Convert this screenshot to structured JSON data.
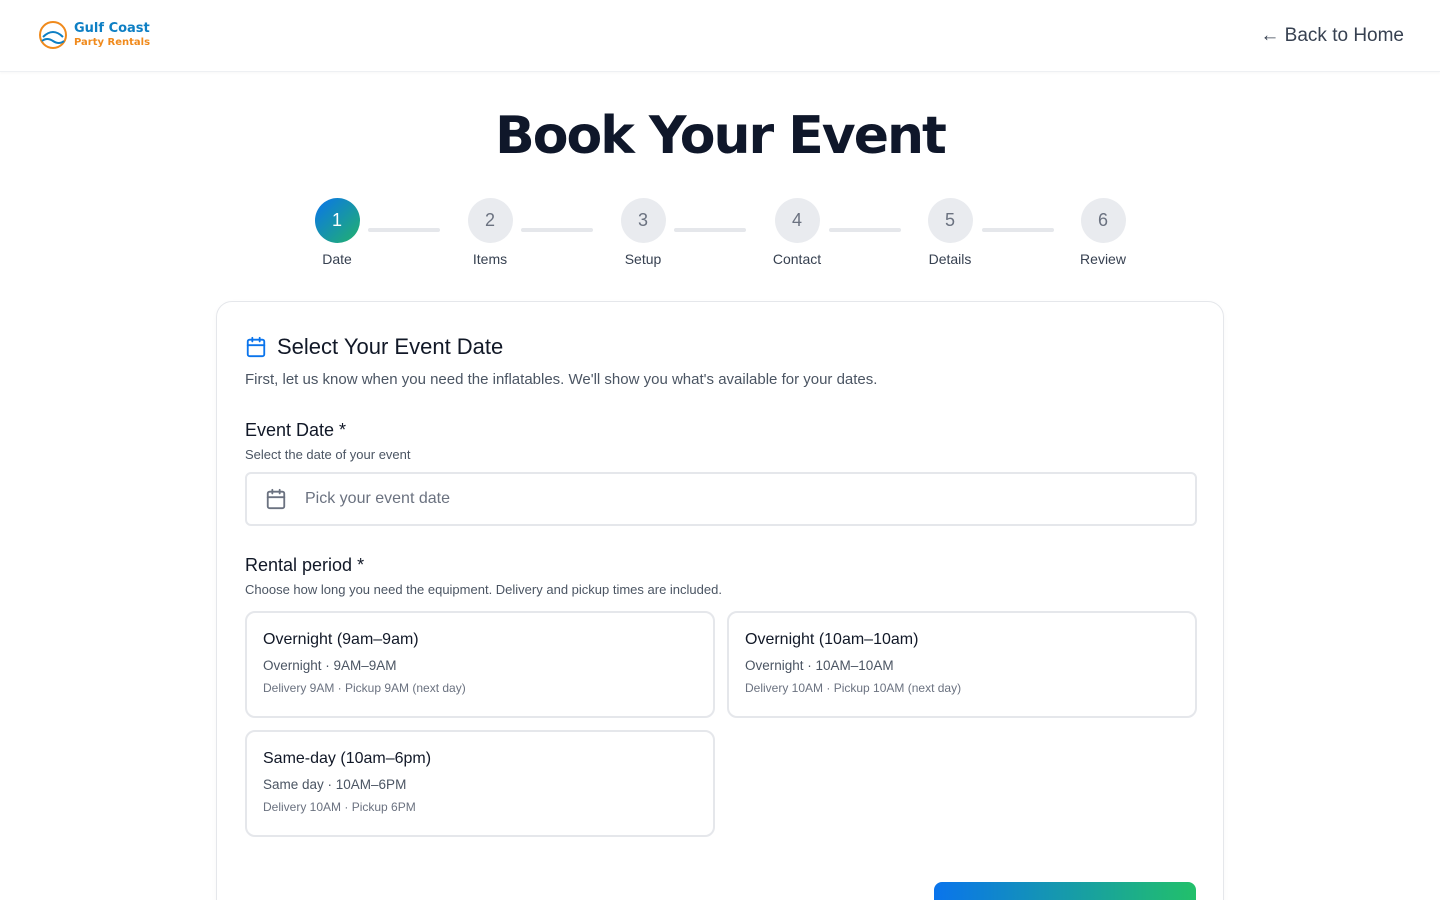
{
  "brand": {
    "line1": "Gulf Coast",
    "line2": "Party Rentals"
  },
  "header": {
    "back_label": "← Back to Home"
  },
  "page": {
    "title": "Book Your Event"
  },
  "steps": [
    {
      "number": "1",
      "label": "Date",
      "active": true
    },
    {
      "number": "2",
      "label": "Items",
      "active": false
    },
    {
      "number": "3",
      "label": "Setup",
      "active": false
    },
    {
      "number": "4",
      "label": "Contact",
      "active": false
    },
    {
      "number": "5",
      "label": "Details",
      "active": false
    },
    {
      "number": "6",
      "label": "Review",
      "active": false
    }
  ],
  "card": {
    "icon": "calendar-icon",
    "title": "Select Your Event Date",
    "description": "First, let us know when you need the inflatables. We'll show you what's available for your dates."
  },
  "event_date": {
    "label": "Event Date *",
    "help": "Select the date of your event",
    "placeholder": "Pick your event date",
    "icon": "calendar-icon"
  },
  "rental_period": {
    "label": "Rental period *",
    "help": "Choose how long you need the equipment. Delivery and pickup times are included.",
    "options": [
      {
        "title": "Overnight (9am–9am)",
        "subtitle": "Overnight · 9AM–9AM",
        "detail": "Delivery 9AM · Pickup 9AM (next day)"
      },
      {
        "title": "Overnight (10am–10am)",
        "subtitle": "Overnight · 10AM–10AM",
        "detail": "Delivery 10AM · Pickup 10AM (next day)"
      },
      {
        "title": "Same-day (10am–6pm)",
        "subtitle": "Same day · 10AM–6PM",
        "detail": "Delivery 10AM · Pickup 6PM"
      }
    ]
  },
  "colors": {
    "accent_start": "#0a74ec",
    "accent_end": "#22b26b",
    "brand_blue": "#0e7fc4",
    "brand_orange": "#f08a1c"
  }
}
